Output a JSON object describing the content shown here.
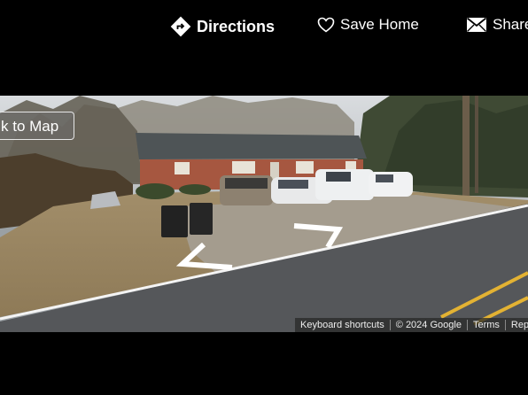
{
  "toolbar": {
    "directions_label": "Directions",
    "save_label": "Save Home",
    "share_label": "Share"
  },
  "streetview": {
    "back_label": "k to Map",
    "attribution": {
      "keyboard": "Keyboard shortcuts",
      "copyright": "© 2024 Google",
      "terms": "Terms",
      "report": "Report"
    }
  }
}
